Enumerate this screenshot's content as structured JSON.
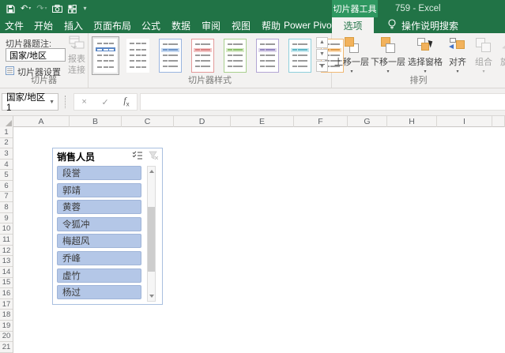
{
  "colors": {
    "excel_green": "#217346",
    "contextual_header_bg": "#2e9760",
    "ribbon_bg": "#f3f2f1",
    "slicer_item_fill": "#b4c7e7",
    "slicer_item_border": "#9fb4d8",
    "slicer_border": "#a9bfdf",
    "arrange_icon_orange": "#f2b25c"
  },
  "titlebar": {
    "contextual_tab_header": "切片器工具",
    "window_title": "759 - Excel",
    "qat_icons": [
      "save-icon",
      "undo-icon",
      "redo-icon",
      "camera-icon",
      "layout-icon",
      "qat-customize-icon"
    ]
  },
  "tabs": [
    {
      "name": "tab-file",
      "label": "文件",
      "active": false
    },
    {
      "name": "tab-home",
      "label": "开始",
      "active": false
    },
    {
      "name": "tab-insert",
      "label": "插入",
      "active": false
    },
    {
      "name": "tab-page-layout",
      "label": "页面布局",
      "active": false
    },
    {
      "name": "tab-formulas",
      "label": "公式",
      "active": false
    },
    {
      "name": "tab-data",
      "label": "数据",
      "active": false
    },
    {
      "name": "tab-review",
      "label": "审阅",
      "active": false
    },
    {
      "name": "tab-view",
      "label": "视图",
      "active": false
    },
    {
      "name": "tab-help",
      "label": "帮助",
      "active": false
    },
    {
      "name": "tab-power-pivot",
      "label": "Power Pivot",
      "active": false
    },
    {
      "name": "tab-slicer-options",
      "label": "选项",
      "active": true
    }
  ],
  "tellme_label": "操作说明搜索",
  "ribbon": {
    "slicer_group": {
      "caption_label": "切片器题注:",
      "caption_value": "国家/地区",
      "settings_label": "切片器设置",
      "report_connections_lines": [
        "报表",
        "连接"
      ],
      "group_label": "切片器"
    },
    "styles_group": {
      "group_label": "切片器样式",
      "thumbs": [
        {
          "name": "slicer-style-light-blue-current",
          "selected": true,
          "frame": "",
          "header_bg": "#5b87c5",
          "header_dash": "#ffffff",
          "dash": "#9a9a9a"
        },
        {
          "name": "slicer-style-none",
          "selected": false,
          "frame": "",
          "header_bg": "",
          "header_dash": "#9a9a9a",
          "dash": "#9a9a9a"
        },
        {
          "name": "slicer-style-light-blue",
          "selected": false,
          "frame": "#9ab5e0",
          "header_bg": "#c6d9f1",
          "header_dash": "#6f96c8",
          "dash": "#9a9a9a"
        },
        {
          "name": "slicer-style-light-red",
          "selected": false,
          "frame": "#e49a9a",
          "header_bg": "#f2c4c4",
          "header_dash": "#d98080",
          "dash": "#9a9a9a"
        },
        {
          "name": "slicer-style-light-green",
          "selected": false,
          "frame": "#a8cf8e",
          "header_bg": "#d8e9c8",
          "header_dash": "#8bbf6a",
          "dash": "#9a9a9a"
        },
        {
          "name": "slicer-style-light-purple",
          "selected": false,
          "frame": "#b3a6d4",
          "header_bg": "#dcd5ea",
          "header_dash": "#9486c0",
          "dash": "#9a9a9a"
        },
        {
          "name": "slicer-style-light-cyan",
          "selected": false,
          "frame": "#8ed0dc",
          "header_bg": "#c9e9ef",
          "header_dash": "#5fb7c8",
          "dash": "#9a9a9a"
        },
        {
          "name": "slicer-style-light-orange",
          "selected": false,
          "frame": "#f0b873",
          "header_bg": "#fad9b0",
          "header_dash": "#e09b46",
          "dash": "#9a9a9a"
        }
      ]
    },
    "arrange_group": {
      "group_label": "排列",
      "buttons": [
        {
          "name": "bring-forward-button",
          "label": "上移一层",
          "icon": "bring-forward",
          "enabled": true
        },
        {
          "name": "send-backward-button",
          "label": "下移一层",
          "icon": "send-backward",
          "enabled": true
        },
        {
          "name": "selection-pane-button",
          "label": "选择窗格",
          "icon": "selection-pane",
          "enabled": true
        },
        {
          "name": "align-button",
          "label": "对齐",
          "icon": "align",
          "enabled": true
        },
        {
          "name": "group-button",
          "label": "组合",
          "icon": "group",
          "enabled": false
        },
        {
          "name": "rotate-button",
          "label": "旋转",
          "icon": "rotate",
          "enabled": false
        }
      ]
    }
  },
  "formula_bar": {
    "name_box_value": "国家/地区 1",
    "cancel_glyph": "×",
    "enter_glyph": "✓"
  },
  "sheet": {
    "columns": [
      "A",
      "B",
      "C",
      "D",
      "E",
      "F",
      "G",
      "H",
      "I",
      ""
    ],
    "rows": [
      "1",
      "2",
      "3",
      "4",
      "5",
      "6",
      "7",
      "8",
      "9",
      "10",
      "11",
      "12",
      "13",
      "14",
      "15",
      "16",
      "17",
      "18",
      "19",
      "20",
      "21"
    ]
  },
  "slicer": {
    "title": "销售人员",
    "items": [
      "段誉",
      "郭靖",
      "黄蓉",
      "令狐冲",
      "梅超风",
      "乔峰",
      "虚竹",
      "杨过"
    ]
  }
}
